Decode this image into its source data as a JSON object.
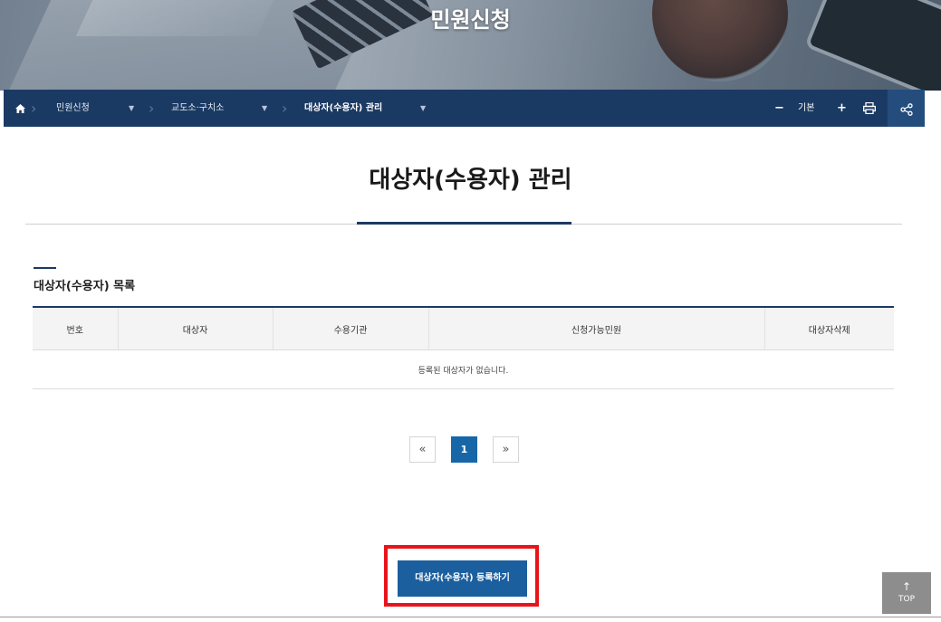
{
  "banner": {
    "title": "민원신청"
  },
  "breadcrumb": {
    "home_icon": "home-icon",
    "items": [
      {
        "label": "민원신청"
      },
      {
        "label": "교도소·구치소"
      },
      {
        "label": "대상자(수용자) 관리"
      }
    ]
  },
  "toolbar": {
    "zoom_out": "−",
    "font_size_label": "기본",
    "zoom_in": "+",
    "print_icon": "print-icon",
    "share_icon": "share-icon"
  },
  "page": {
    "title": "대상자(수용자) 관리",
    "section_title": "대상자(수용자) 목록"
  },
  "table": {
    "columns": [
      "번호",
      "대상자",
      "수용기관",
      "신청가능민원",
      "대상자삭제"
    ],
    "empty_message": "등록된 대상자가 없습니다."
  },
  "pagination": {
    "prev": "«",
    "current": "1",
    "next": "»"
  },
  "actions": {
    "register_label": "대상자(수용자) 등록하기"
  },
  "top_button": {
    "arrow": "↑",
    "label": "TOP"
  },
  "colors": {
    "nav_bg": "#1b3a63",
    "accent": "#1767a8",
    "highlight": "#e8141b"
  }
}
